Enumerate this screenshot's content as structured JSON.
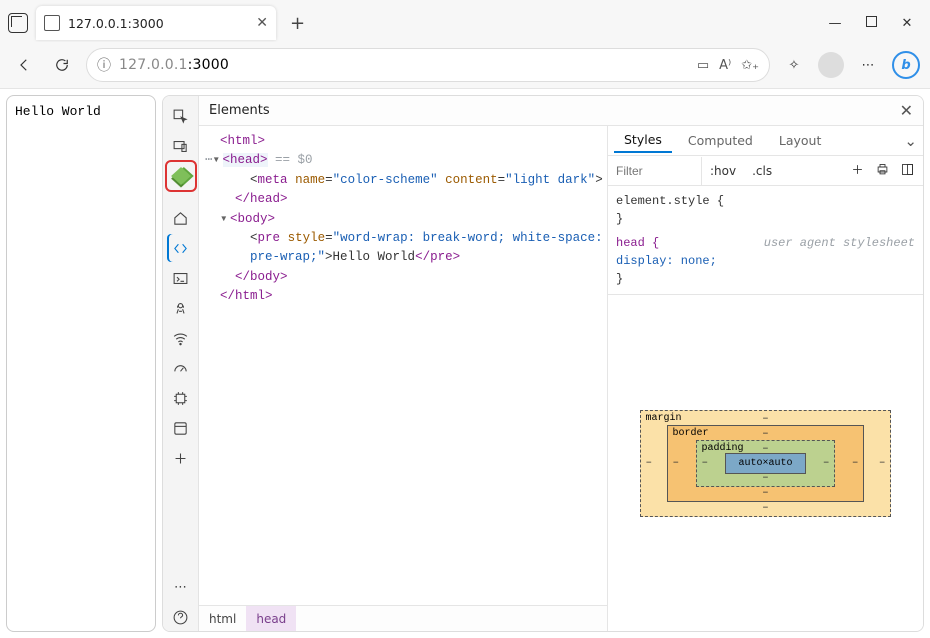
{
  "tab": {
    "title": "127.0.0.1:3000"
  },
  "url": {
    "host": "127.0.0.1",
    "port": ":3000"
  },
  "page": {
    "text": "Hello World"
  },
  "devtools": {
    "panel": "Elements",
    "dom": {
      "l_html_open": "<html>",
      "l_head_open": "<head>",
      "head_eq0": " == $0",
      "meta_tag": "meta",
      "meta_attr1": "name",
      "meta_val1": "\"color-scheme\"",
      "meta_attr2": "content",
      "meta_val2": "\"light dark\"",
      "l_head_close": "</head>",
      "l_body_open": "<body>",
      "pre_open_tag": "pre",
      "pre_attr": "style",
      "pre_val": "\"word-wrap: break-word; white-space:",
      "pre_val2": "pre-wrap;\"",
      "pre_text": "Hello World",
      "pre_close": "</pre>",
      "l_body_close": "</body>",
      "l_html_close": "</html>"
    },
    "breadcrumb": {
      "a": "html",
      "b": "head"
    },
    "styles": {
      "tabs": {
        "styles": "Styles",
        "computed": "Computed",
        "layout": "Layout"
      },
      "filter_placeholder": "Filter",
      "hov": ":hov",
      "cls": ".cls",
      "element_style": "element.style {",
      "close_brace": "}",
      "head_sel": "head {",
      "head_rule": "    display: none;",
      "uas": "user agent stylesheet"
    },
    "boxmodel": {
      "margin": "margin",
      "border": "border",
      "padding": "padding",
      "content": "auto×auto",
      "dash": "–"
    }
  }
}
